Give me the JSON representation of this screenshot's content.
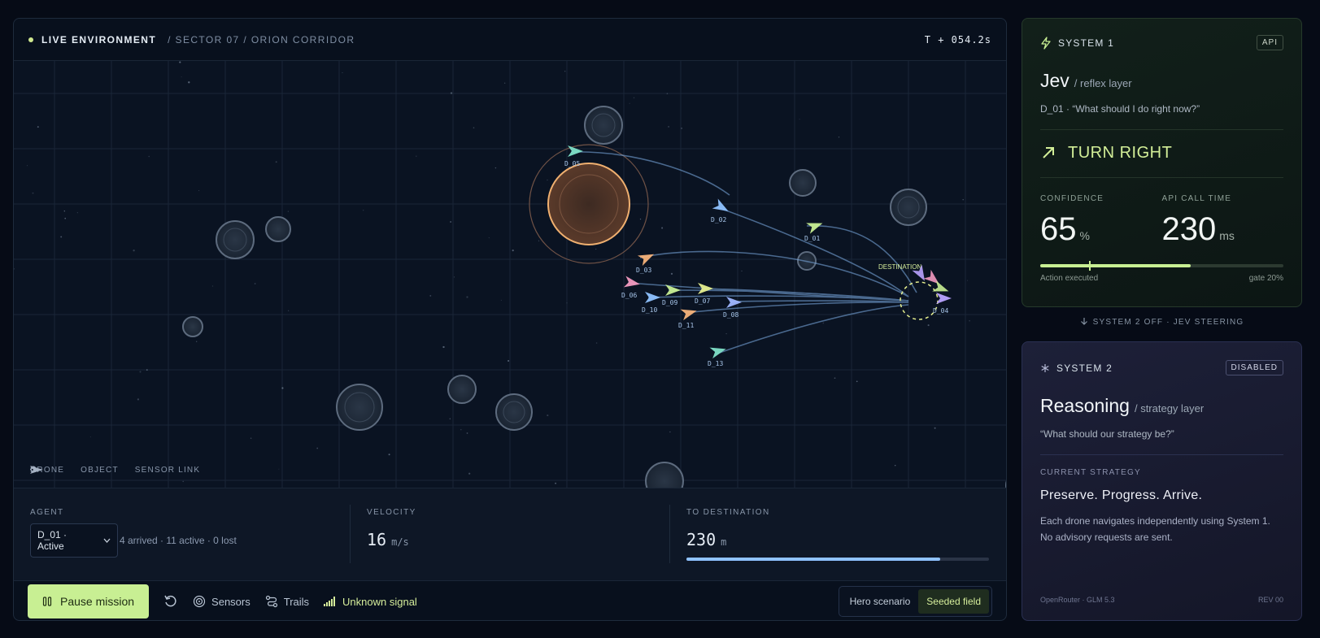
{
  "header": {
    "live_label": "LIVE ENVIRONMENT",
    "breadcrumb": "/ SECTOR 07 / ORION CORRIDOR",
    "clock": "T + 054.2s"
  },
  "map": {
    "destination_label": "DESTINATION",
    "drones": [
      {
        "id": "D_05",
        "color": "#7fe0c8"
      },
      {
        "id": "D_02",
        "color": "#8fc2ff"
      },
      {
        "id": "D_01",
        "color": "#c8ef93"
      },
      {
        "id": "D_03",
        "color": "#f5b27a"
      },
      {
        "id": "D_06",
        "color": "#f39ac0"
      },
      {
        "id": "D_10",
        "color": "#8fc2ff"
      },
      {
        "id": "D_09",
        "color": "#c8ef93"
      },
      {
        "id": "D_07",
        "color": "#e6ef8f"
      },
      {
        "id": "D_11",
        "color": "#f5b27a"
      },
      {
        "id": "D_08",
        "color": "#9fb6ff"
      },
      {
        "id": "D_13",
        "color": "#7fe0c8"
      },
      {
        "id": "D_04",
        "color": "#b9a3ff"
      }
    ]
  },
  "legend": {
    "drone": "DRONE",
    "object": "OBJECT",
    "sensor_link": "SENSOR LINK"
  },
  "stats": {
    "agent_label": "AGENT",
    "agent_selected": "D_01 · Active",
    "agent_summary": "4 arrived · 11 active · 0 lost",
    "velocity_label": "VELOCITY",
    "velocity_value": "16",
    "velocity_unit": "m/s",
    "dest_label": "TO DESTINATION",
    "dest_value": "230",
    "dest_unit": "m",
    "dest_progress": 0.84
  },
  "controls": {
    "pause_label": "Pause mission",
    "sensors_label": "Sensors",
    "trails_label": "Trails",
    "signal_label": "Unknown signal",
    "hero_label": "Hero scenario",
    "seeded_label": "Seeded field"
  },
  "system1": {
    "heading": "SYSTEM 1",
    "badge": "API",
    "title": "Jev",
    "subtitle": "/ reflex layer",
    "quote": "D_01 · “What should I do right now?”",
    "action": "TURN RIGHT",
    "confidence_label": "CONFIDENCE",
    "confidence_value": "65",
    "confidence_unit": "%",
    "api_label": "API CALL TIME",
    "api_value": "230",
    "api_unit": "ms",
    "bar_fill": 0.62,
    "gate_fraction": 0.2,
    "bar_left": "Action executed",
    "bar_right": "gate 20%"
  },
  "between": "SYSTEM 2 OFF · JEV STEERING",
  "system2": {
    "heading": "SYSTEM 2",
    "badge": "DISABLED",
    "title": "Reasoning",
    "subtitle": "/ strategy layer",
    "quote": "“What should our strategy be?”",
    "strategy_label": "CURRENT STRATEGY",
    "strategy_title": "Preserve. Progress. Arrive.",
    "strategy_desc": "Each drone navigates independently using System 1. No advisory requests are sent.",
    "foot_left": "OpenRouter · GLM 5.3",
    "foot_right": "REV 00"
  },
  "colors": {
    "accent_green": "#c8ef93",
    "accent_blue": "#8fc2ff",
    "hazard_orange": "#f0b070"
  }
}
